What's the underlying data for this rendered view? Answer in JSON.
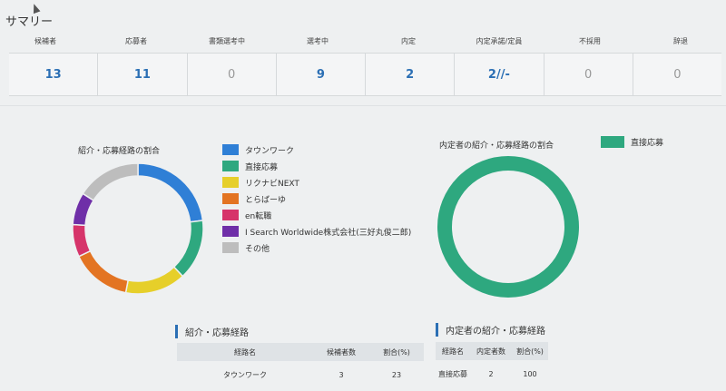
{
  "summary": {
    "title": "サマリー",
    "columns": [
      {
        "label": "候補者",
        "value": "13"
      },
      {
        "label": "応募者",
        "value": "11"
      },
      {
        "label": "書類選考中",
        "value": "0"
      },
      {
        "label": "選考中",
        "value": "9"
      },
      {
        "label": "内定",
        "value": "2"
      },
      {
        "label": "内定承諾/定員",
        "value": "2//-"
      },
      {
        "label": "不採用",
        "value": "0"
      },
      {
        "label": "辞退",
        "value": "0"
      }
    ]
  },
  "route_chart": {
    "title": "紹介・応募経路の割合",
    "legend": [
      {
        "label": "タウンワーク",
        "color": "#2f7fd6"
      },
      {
        "label": "直接応募",
        "color": "#2ea87f"
      },
      {
        "label": "リクナビNEXT",
        "color": "#e6cf2a"
      },
      {
        "label": "とらばーゆ",
        "color": "#e37422"
      },
      {
        "label": "en転職",
        "color": "#d6346a"
      },
      {
        "label": "I Search Worldwide株式会社(三好丸俊二郎)",
        "color": "#6f2fa8"
      },
      {
        "label": "その他",
        "color": "#bdbdbd"
      }
    ],
    "slices": [
      {
        "name": "タウンワーク",
        "percent": 23,
        "color": "#2f7fd6"
      },
      {
        "name": "直接応募",
        "percent": 15,
        "color": "#2ea87f"
      },
      {
        "name": "リクナビNEXT",
        "percent": 15,
        "color": "#e6cf2a"
      },
      {
        "name": "とらばーゆ",
        "percent": 15,
        "color": "#e37422"
      },
      {
        "name": "en転職",
        "percent": 8,
        "color": "#d6346a"
      },
      {
        "name": "I Search Worldwide株式会社(三好丸俊二郎)",
        "percent": 8,
        "color": "#6f2fa8"
      },
      {
        "name": "その他",
        "percent": 16,
        "color": "#bdbdbd"
      }
    ]
  },
  "offer_chart": {
    "title": "内定者の紹介・応募経路の割合",
    "legend_label": "直接応募",
    "color": "#2ea87f",
    "percent": 100
  },
  "route_table": {
    "title": "紹介・応募経路",
    "headers": [
      "経路名",
      "候補者数",
      "割合(%)"
    ],
    "rows": [
      [
        "タウンワーク",
        "3",
        "23"
      ]
    ]
  },
  "offer_table": {
    "title": "内定者の紹介・応募経路",
    "headers": [
      "経路名",
      "内定者数",
      "割合(%)"
    ],
    "rows": [
      [
        "直接応募",
        "2",
        "100"
      ]
    ]
  }
}
